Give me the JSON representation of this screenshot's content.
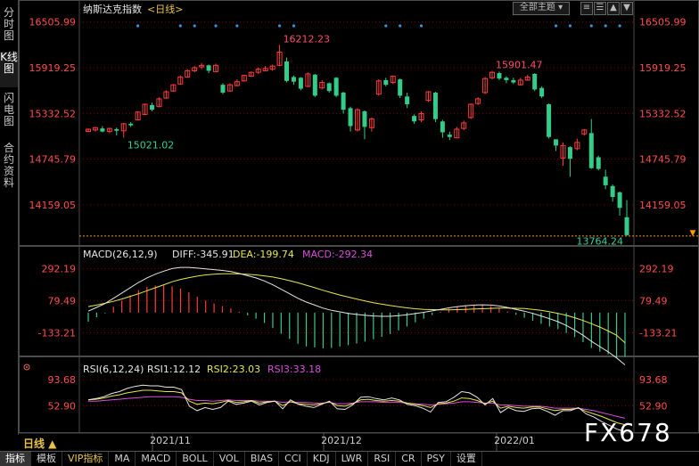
{
  "sidebar": {
    "tabs": [
      "分时图",
      "K线图",
      "闪电图",
      "合约资料"
    ],
    "active": 1
  },
  "chart_header": {
    "name": "纳斯达克指数",
    "period": "<日线>"
  },
  "topbar": {
    "main_select": "全部主题",
    "icons": [
      "settings-icon",
      "list-icon",
      "up-arrow-icon",
      "down-arrow-icon"
    ]
  },
  "period_label": "日线 ▲",
  "watermark": "FX678",
  "x_labels": [
    "2021/11",
    "2021/12",
    "2022/01"
  ],
  "bottom_tabs": [
    "指标",
    "模板",
    "VIP指标",
    "MA",
    "MACD",
    "BOLL",
    "VOL",
    "BIAS",
    "CCI",
    "KDJ",
    "LWR",
    "RSI",
    "CR",
    "PSY",
    "设置"
  ],
  "active_bottom_tab": 0,
  "macd_legend": {
    "title": "MACD(26,12,9)",
    "diff": "DIFF:-345.91",
    "dea": "DEA:-199.74",
    "macd": "MACD:-292.34"
  },
  "rsi_legend": {
    "title": "RSI(6,12,24)",
    "rsi1": "RSI1:12.12",
    "rsi2": "RSI2:23.03",
    "rsi3": "RSI3:33.18"
  },
  "colors": {
    "up": "#ff3b3b",
    "down": "#33cc88",
    "grid": "#800000",
    "axis_label": "#ff4d4d",
    "diff": "#e6e6e6",
    "dea": "#e8e84a",
    "rsi3": "#d94fd9",
    "annotation_up": "#ff4d6a",
    "annotation_down": "#33d29a",
    "ref_line": "#ff9900"
  },
  "chart_data": [
    {
      "type": "candlestick",
      "title": "纳斯达克指数 <日线>",
      "y_ticks": [
        "16505.99",
        "15919.25",
        "15332.52",
        "14745.79",
        "14159.05"
      ],
      "ylim": [
        13700,
        16560
      ],
      "annotations": [
        {
          "text": "16212.23",
          "kind": "high"
        },
        {
          "text": "15901.47",
          "kind": "high"
        },
        {
          "text": "15021.02",
          "kind": "low"
        },
        {
          "text": "13764.24",
          "kind": "low"
        }
      ],
      "candles": [
        [
          15100,
          15130,
          15090,
          15140
        ],
        [
          15120,
          15150,
          15100,
          15160
        ],
        [
          15140,
          15100,
          15090,
          15170
        ],
        [
          15100,
          15140,
          15080,
          15150
        ],
        [
          15130,
          15110,
          15050,
          15150
        ],
        [
          15110,
          15200,
          15020,
          15210
        ],
        [
          15200,
          15180,
          15160,
          15220
        ],
        [
          15250,
          15350,
          15240,
          15360
        ],
        [
          15320,
          15450,
          15310,
          15460
        ],
        [
          15440,
          15380,
          15360,
          15470
        ],
        [
          15420,
          15520,
          15410,
          15540
        ],
        [
          15530,
          15610,
          15520,
          15630
        ],
        [
          15620,
          15700,
          15610,
          15710
        ],
        [
          15710,
          15800,
          15700,
          15820
        ],
        [
          15800,
          15880,
          15790,
          15900
        ],
        [
          15880,
          15920,
          15860,
          15940
        ],
        [
          15930,
          15950,
          15900,
          15980
        ],
        [
          15950,
          15880,
          15850,
          15960
        ],
        [
          15870,
          15950,
          15860,
          15970
        ],
        [
          15700,
          15600,
          15580,
          15720
        ],
        [
          15620,
          15700,
          15610,
          15720
        ],
        [
          15690,
          15740,
          15680,
          15770
        ],
        [
          15750,
          15820,
          15740,
          15830
        ],
        [
          15810,
          15860,
          15800,
          15870
        ],
        [
          15860,
          15900,
          15840,
          15920
        ],
        [
          15880,
          15910,
          15870,
          15940
        ],
        [
          15900,
          15940,
          15880,
          15960
        ],
        [
          15950,
          16120,
          15940,
          16212
        ],
        [
          16000,
          15750,
          15730,
          16050
        ],
        [
          15800,
          15740,
          15700,
          15820
        ],
        [
          15790,
          15650,
          15630,
          15800
        ],
        [
          15680,
          15840,
          15670,
          15860
        ],
        [
          15830,
          15560,
          15540,
          15840
        ],
        [
          15660,
          15730,
          15640,
          15760
        ],
        [
          15720,
          15620,
          15600,
          15730
        ],
        [
          15790,
          15560,
          15540,
          15800
        ],
        [
          15600,
          15380,
          15330,
          15610
        ],
        [
          15400,
          15170,
          15100,
          15420
        ],
        [
          15120,
          15380,
          15100,
          15400
        ],
        [
          15360,
          15160,
          15000,
          15370
        ],
        [
          15150,
          15260,
          15100,
          15280
        ],
        [
          15580,
          15750,
          15560,
          15770
        ],
        [
          15760,
          15700,
          15680,
          15790
        ],
        [
          15730,
          15810,
          15710,
          15820
        ],
        [
          15770,
          15560,
          15530,
          15780
        ],
        [
          15550,
          15450,
          15400,
          15600
        ],
        [
          15300,
          15230,
          15200,
          15320
        ],
        [
          15250,
          15330,
          15220,
          15360
        ],
        [
          15500,
          15610,
          15480,
          15620
        ],
        [
          15600,
          15260,
          15220,
          15610
        ],
        [
          15230,
          15090,
          15020,
          15250
        ],
        [
          15060,
          15030,
          14990,
          15100
        ],
        [
          15020,
          15130,
          15010,
          15160
        ],
        [
          15140,
          15210,
          15120,
          15240
        ],
        [
          15280,
          15450,
          15260,
          15460
        ],
        [
          15460,
          15520,
          15440,
          15540
        ],
        [
          15600,
          15780,
          15580,
          15800
        ],
        [
          15790,
          15860,
          15770,
          15880
        ],
        [
          15850,
          15780,
          15760,
          15870
        ],
        [
          15790,
          15760,
          15720,
          15810
        ],
        [
          15760,
          15730,
          15710,
          15790
        ],
        [
          15700,
          15760,
          15690,
          15790
        ],
        [
          15760,
          15800,
          15750,
          15830
        ],
        [
          15840,
          15640,
          15620,
          15850
        ],
        [
          15660,
          15550,
          15530,
          15680
        ],
        [
          15450,
          15030,
          15010,
          15460
        ],
        [
          15000,
          14920,
          14850,
          14990
        ],
        [
          14760,
          14920,
          14660,
          14960
        ],
        [
          14900,
          14750,
          14520,
          14910
        ],
        [
          14880,
          14960,
          14860,
          15010
        ],
        [
          15070,
          15120,
          15050,
          15130
        ],
        [
          15080,
          14630,
          14620,
          15260
        ],
        [
          14770,
          14620,
          14600,
          14790
        ],
        [
          14520,
          14410,
          14360,
          14610
        ],
        [
          14400,
          14260,
          14200,
          14420
        ],
        [
          14320,
          14120,
          14020,
          14330
        ],
        [
          14000,
          13770,
          13764,
          14220
        ]
      ]
    },
    {
      "type": "line+bar",
      "title": "MACD(26,12,9)",
      "y_ticks": [
        "292.19",
        "79.49",
        "-133.21"
      ],
      "ylim": [
        -290,
        330
      ],
      "series": [
        {
          "name": "DIFF",
          "values": [
            10,
            35,
            60,
            95,
            130,
            165,
            200,
            230,
            255,
            275,
            292,
            300,
            300,
            295,
            290,
            285,
            280,
            272,
            260,
            245,
            230,
            210,
            185,
            155,
            125,
            95,
            70,
            50,
            30,
            15,
            5,
            -5,
            -12,
            -18,
            -22,
            -24,
            -24,
            -20,
            -14,
            -6,
            2,
            12,
            22,
            32,
            40,
            46,
            50,
            52,
            50,
            44,
            34,
            22,
            10,
            -5,
            -22,
            -40,
            -60,
            -85,
            -115,
            -150,
            -190,
            -225,
            -260,
            -300,
            -345.91
          ]
        },
        {
          "name": "DEA",
          "values": [
            40,
            50,
            62,
            75,
            90,
            108,
            125,
            145,
            165,
            185,
            205,
            220,
            232,
            242,
            250,
            255,
            258,
            258,
            257,
            254,
            250,
            244,
            236,
            225,
            212,
            198,
            182,
            165,
            148,
            132,
            117,
            103,
            90,
            78,
            66,
            56,
            47,
            39,
            32,
            26,
            22,
            20,
            19,
            19,
            20,
            22,
            24,
            26,
            28,
            30,
            30,
            29,
            27,
            22,
            15,
            6,
            -5,
            -18,
            -34,
            -52,
            -73,
            -96,
            -122,
            -150,
            -199.74
          ]
        },
        {
          "name": "MACD",
          "values": [
            -60,
            -30,
            -5,
            40,
            80,
            115,
            150,
            170,
            180,
            180,
            174,
            160,
            136,
            106,
            80,
            60,
            44,
            28,
            6,
            -18,
            -40,
            -68,
            -102,
            -140,
            -174,
            -206,
            -224,
            -230,
            -236,
            -234,
            -224,
            -216,
            -204,
            -192,
            -176,
            -160,
            -142,
            -118,
            -92,
            -64,
            -40,
            -16,
            6,
            26,
            40,
            48,
            52,
            52,
            44,
            28,
            8,
            -14,
            -34,
            -54,
            -74,
            -92,
            -110,
            -134,
            -162,
            -196,
            -234,
            -258,
            -276,
            -300,
            -292.34
          ]
        }
      ]
    },
    {
      "type": "line",
      "title": "RSI(6,12,24)",
      "y_ticks": [
        "93.68",
        "52.90"
      ],
      "ylim": [
        10,
        105
      ],
      "series": [
        {
          "name": "RSI1",
          "values": [
            62,
            64,
            67,
            72,
            75,
            80,
            83,
            85,
            84,
            84,
            82,
            82,
            78,
            52,
            45,
            50,
            47,
            50,
            60,
            55,
            57,
            60,
            54,
            58,
            60,
            48,
            62,
            55,
            52,
            50,
            55,
            60,
            48,
            47,
            54,
            66,
            67,
            64,
            62,
            65,
            62,
            55,
            53,
            49,
            43,
            58,
            59,
            66,
            75,
            73,
            66,
            54,
            64,
            42,
            50,
            45,
            44,
            48,
            49,
            44,
            38,
            45,
            45,
            50,
            40,
            35,
            28,
            22,
            16,
            12.12
          ]
        },
        {
          "name": "RSI2",
          "values": [
            62,
            63,
            65,
            68,
            70,
            73,
            75,
            77,
            77,
            76,
            75,
            75,
            73,
            60,
            55,
            57,
            56,
            58,
            61,
            58,
            59,
            61,
            57,
            59,
            60,
            53,
            59,
            56,
            55,
            54,
            56,
            59,
            53,
            52,
            56,
            62,
            63,
            61,
            60,
            61,
            60,
            57,
            55,
            53,
            50,
            56,
            57,
            60,
            65,
            64,
            61,
            56,
            60,
            49,
            52,
            50,
            49,
            51,
            51,
            48,
            45,
            47,
            47,
            49,
            44,
            40,
            36,
            31,
            26,
            23.03
          ]
        },
        {
          "name": "RSI3",
          "values": [
            60,
            60,
            61,
            62,
            63,
            64,
            65,
            66,
            67,
            67,
            67,
            67,
            66,
            63,
            61,
            61,
            60,
            61,
            62,
            61,
            61,
            61,
            60,
            60,
            60,
            58,
            59,
            58,
            58,
            57,
            57,
            58,
            56,
            56,
            57,
            59,
            59,
            59,
            58,
            58,
            58,
            57,
            56,
            55,
            54,
            55,
            56,
            57,
            59,
            59,
            58,
            57,
            57,
            54,
            54,
            53,
            52,
            52,
            52,
            51,
            49,
            49,
            49,
            49,
            47,
            45,
            42,
            39,
            36,
            33.18
          ]
        }
      ]
    }
  ]
}
